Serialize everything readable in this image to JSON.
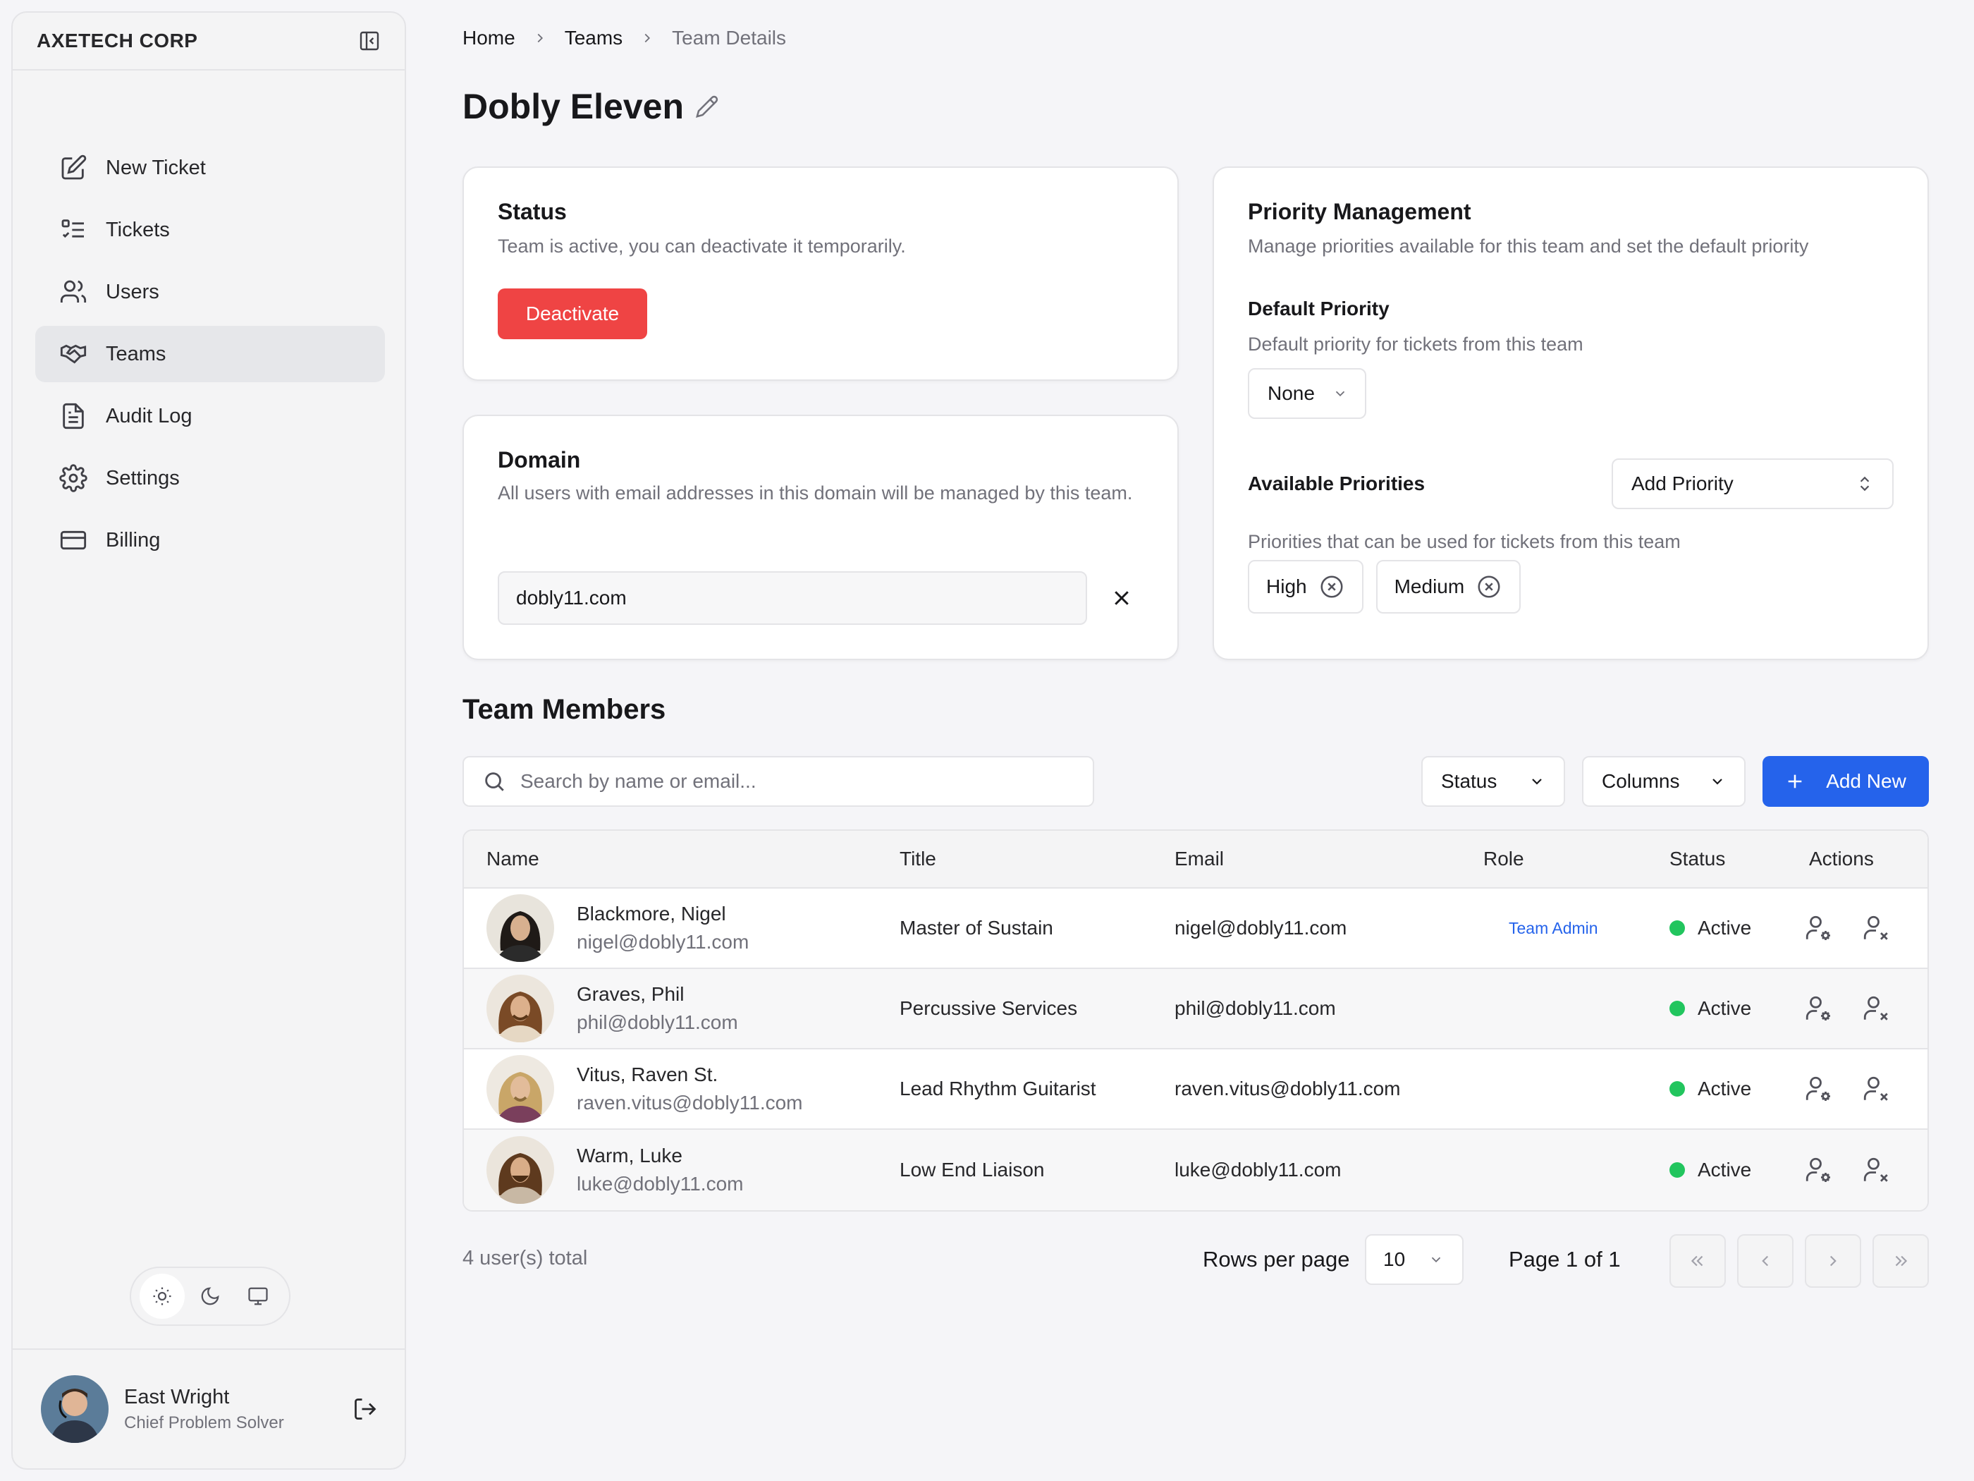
{
  "sidebar": {
    "brand": "AXETECH CORP",
    "nav": [
      {
        "label": "New Ticket",
        "icon": "edit-square-icon"
      },
      {
        "label": "Tickets",
        "icon": "list-check-icon"
      },
      {
        "label": "Users",
        "icon": "users-icon"
      },
      {
        "label": "Teams",
        "icon": "handshake-icon",
        "active": true
      },
      {
        "label": "Audit Log",
        "icon": "document-icon"
      },
      {
        "label": "Settings",
        "icon": "gear-icon"
      },
      {
        "label": "Billing",
        "icon": "credit-card-icon"
      }
    ],
    "theme_active": "light",
    "user": {
      "name": "East Wright",
      "role": "Chief Problem Solver"
    }
  },
  "breadcrumb": [
    "Home",
    "Teams",
    "Team Details"
  ],
  "page_title": "Dobly Eleven",
  "status_card": {
    "title": "Status",
    "description": "Team is active, you can deactivate it temporarily.",
    "button": "Deactivate"
  },
  "domain_card": {
    "title": "Domain",
    "description": "All users with email addresses in this domain will be managed by this team.",
    "value": "dobly11.com"
  },
  "priority_card": {
    "title": "Priority Management",
    "description": "Manage priorities available for this team and set the default priority",
    "default_label": "Default Priority",
    "default_description": "Default priority for tickets from this team",
    "default_value": "None",
    "available_label": "Available Priorities",
    "add_button": "Add Priority",
    "available_description": "Priorities that can be used for tickets from this team",
    "chips": [
      "High",
      "Medium"
    ]
  },
  "members": {
    "title": "Team Members",
    "search_placeholder": "Search by name or email...",
    "status_filter": "Status",
    "columns_button": "Columns",
    "add_button": "Add New",
    "headers": {
      "name": "Name",
      "title": "Title",
      "email": "Email",
      "role": "Role",
      "status": "Status",
      "actions": "Actions"
    },
    "rows": [
      {
        "name": "Blackmore, Nigel",
        "sub_email": "nigel@dobly11.com",
        "title": "Master of Sustain",
        "email": "nigel@dobly11.com",
        "role": "Team Admin",
        "status": "Active"
      },
      {
        "name": "Graves, Phil",
        "sub_email": "phil@dobly11.com",
        "title": "Percussive Services",
        "email": "phil@dobly11.com",
        "role": "",
        "status": "Active"
      },
      {
        "name": "Vitus, Raven St.",
        "sub_email": "raven.vitus@dobly11.com",
        "title": "Lead Rhythm Guitarist",
        "email": "raven.vitus@dobly11.com",
        "role": "",
        "status": "Active"
      },
      {
        "name": "Warm, Luke",
        "sub_email": "luke@dobly11.com",
        "title": "Low End Liaison",
        "email": "luke@dobly11.com",
        "role": "",
        "status": "Active"
      }
    ],
    "total": "4 user(s) total",
    "rows_per_page_label": "Rows per page",
    "rows_per_page": "10",
    "page_info": "Page 1 of 1"
  },
  "colors": {
    "danger": "#ef4444",
    "primary": "#2563eb",
    "active": "#22c55e"
  }
}
